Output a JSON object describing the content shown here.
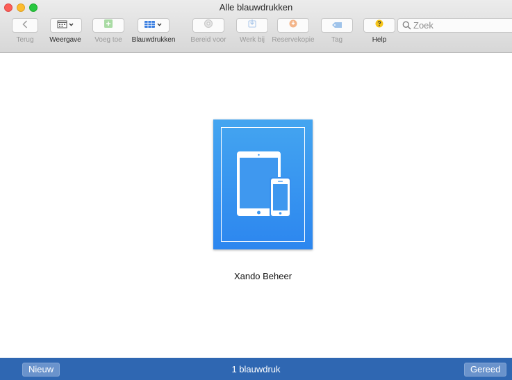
{
  "window": {
    "title": "Alle blauwdrukken"
  },
  "toolbar": {
    "back_label": "Terug",
    "view_label": "Weergave",
    "add_label": "Voeg toe",
    "blueprints_label": "Blauwdrukken",
    "prepare_label": "Bereid voor",
    "update_label": "Werk bij",
    "backup_label": "Reservekopie",
    "tag_label": "Tag",
    "help_label": "Help"
  },
  "search": {
    "placeholder": "Zoek",
    "value": ""
  },
  "blueprints": [
    {
      "name": "Xando Beheer",
      "icon": "ipad-iphone-icon",
      "color": "#2f8cef"
    }
  ],
  "footer": {
    "new_label": "Nieuw",
    "count_text": "1 blauwdruk",
    "done_label": "Gereed"
  },
  "colors": {
    "footer": "#2f67b2",
    "card_top": "#44a5f0",
    "card_bottom": "#2c86ef"
  }
}
